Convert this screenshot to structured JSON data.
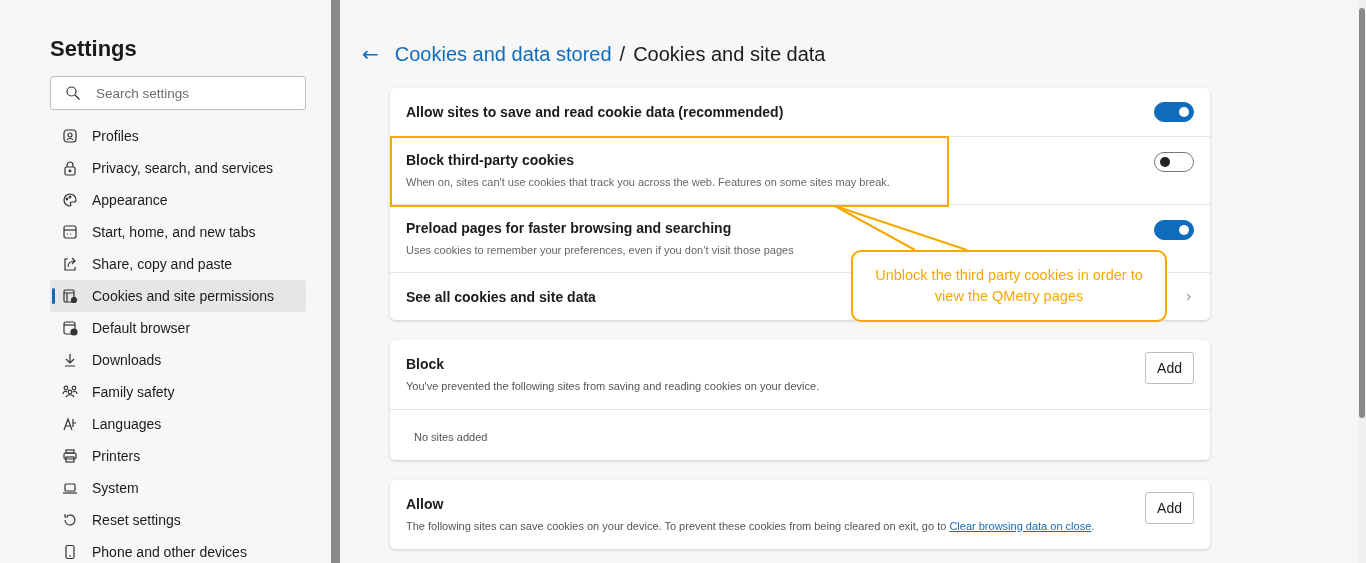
{
  "sidebar": {
    "title": "Settings",
    "search": {
      "placeholder": "Search settings"
    },
    "items": [
      {
        "label": "Profiles",
        "selected": false
      },
      {
        "label": "Privacy, search, and services",
        "selected": false
      },
      {
        "label": "Appearance",
        "selected": false
      },
      {
        "label": "Start, home, and new tabs",
        "selected": false
      },
      {
        "label": "Share, copy and paste",
        "selected": false
      },
      {
        "label": "Cookies and site permissions",
        "selected": true
      },
      {
        "label": "Default browser",
        "selected": false
      },
      {
        "label": "Downloads",
        "selected": false
      },
      {
        "label": "Family safety",
        "selected": false
      },
      {
        "label": "Languages",
        "selected": false
      },
      {
        "label": "Printers",
        "selected": false
      },
      {
        "label": "System",
        "selected": false
      },
      {
        "label": "Reset settings",
        "selected": false
      },
      {
        "label": "Phone and other devices",
        "selected": false
      }
    ]
  },
  "header": {
    "back": "←",
    "parent": "Cookies and data stored",
    "separator": "/",
    "title": "Cookies and site data"
  },
  "settings": [
    {
      "kind": "toggle",
      "label": "Allow sites to save and read cookie data (recommended)",
      "on": true,
      "highlighted": false
    },
    {
      "kind": "toggle",
      "label": "Block third-party cookies",
      "description": "When on, sites can't use cookies that track you across the web. Features on some sites may break.",
      "on": false,
      "highlighted": true
    },
    {
      "kind": "toggle",
      "label": "Preload pages for faster browsing and searching",
      "description": "Uses cookies to remember your preferences, even if you don’t visit those pages",
      "on": true,
      "highlighted": false
    },
    {
      "kind": "link",
      "label": "See all cookies and site data"
    }
  ],
  "callout": {
    "text": "Unblock the third party cookies in order to view the QMetry pages"
  },
  "lists": [
    {
      "title": "Block",
      "description": "You've prevented the following sites from saving and reading cookies on your device.",
      "button": "Add",
      "empty": "No sites added"
    },
    {
      "title": "Allow",
      "description": "The following sites can save cookies on your device. To prevent these cookies from being cleared on exit, go to",
      "link": "Clear browsing data on close",
      "after": ".",
      "button": "Add"
    }
  ]
}
